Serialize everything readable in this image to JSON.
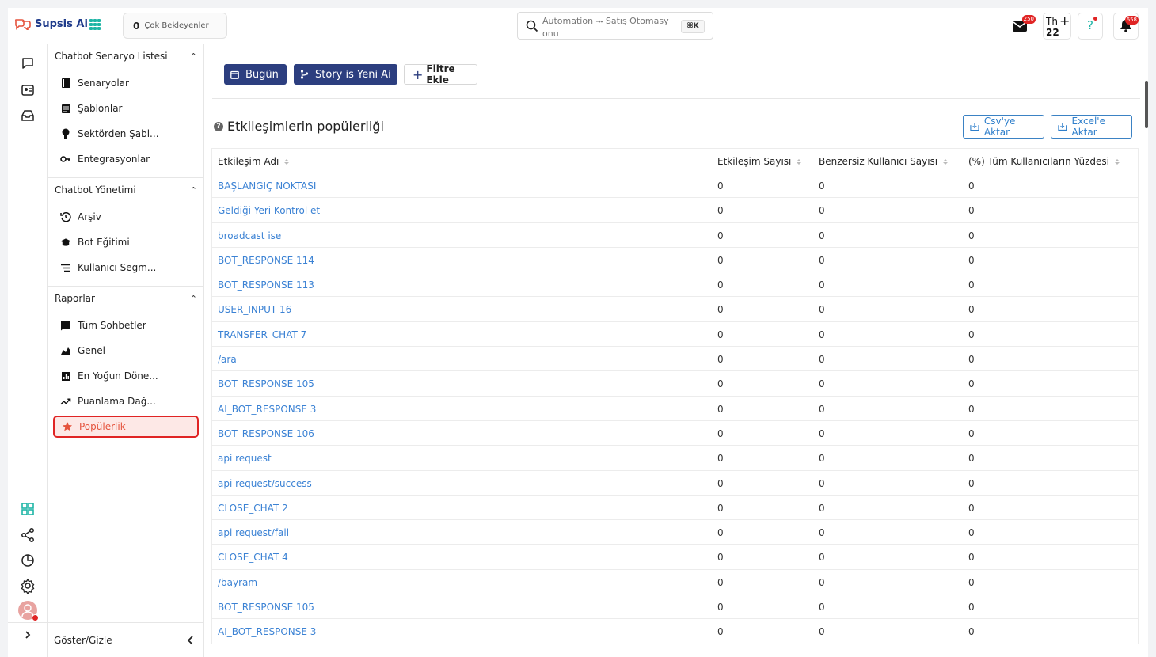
{
  "app": {
    "logo_text": "Supsis Ai"
  },
  "topbar": {
    "pending_count": "0",
    "pending_label": "Çok Bekleyenler",
    "search_text": "Automation ⤞ Satış Otomasy onu",
    "search_shortcut": "⌘K",
    "mail_badge": "250",
    "th_label": "Th",
    "th_count": "22",
    "help_label": "?",
    "bell_badge": "658"
  },
  "sidebar": {
    "sections": [
      {
        "title": "Chatbot Senaryo Listesi",
        "items": [
          "Senaryolar",
          "Şablonlar",
          "Sektörden Şabl...",
          "Entegrasyonlar"
        ]
      },
      {
        "title": "Chatbot Yönetimi",
        "items": [
          "Arşiv",
          "Bot Eğitimi",
          "Kullanıcı Segm..."
        ]
      },
      {
        "title": "Raporlar",
        "items": [
          "Tüm Sohbetler",
          "Genel",
          "En Yoğun Döne...",
          "Puanlama Dağ...",
          "Popülerlik"
        ]
      }
    ],
    "footer_label": "Göster/Gizle"
  },
  "toolbar": {
    "today_label": "Bugün",
    "story_label": "Story is Yeni Ai",
    "filter_label": "Filtre Ekle"
  },
  "section": {
    "title": "Etkileşimlerin popülerliği",
    "csv_label": "Csv'ye Aktar",
    "excel_label": "Excel'e Aktar"
  },
  "table": {
    "headers": [
      "Etkileşim Adı",
      "Etkileşim Sayısı",
      "Benzersiz Kullanıcı Sayısı",
      "(%) Tüm Kullanıcıların Yüzdesi"
    ],
    "rows": [
      [
        "BAŞLANGIÇ NOKTASI",
        "0",
        "0",
        "0"
      ],
      [
        "Geldiği Yeri Kontrol et",
        "0",
        "0",
        "0"
      ],
      [
        "broadcast ise",
        "0",
        "0",
        "0"
      ],
      [
        "BOT_RESPONSE 114",
        "0",
        "0",
        "0"
      ],
      [
        "BOT_RESPONSE 113",
        "0",
        "0",
        "0"
      ],
      [
        "USER_INPUT 16",
        "0",
        "0",
        "0"
      ],
      [
        "TRANSFER_CHAT 7",
        "0",
        "0",
        "0"
      ],
      [
        "/ara",
        "0",
        "0",
        "0"
      ],
      [
        "BOT_RESPONSE 105",
        "0",
        "0",
        "0"
      ],
      [
        "AI_BOT_RESPONSE 3",
        "0",
        "0",
        "0"
      ],
      [
        "BOT_RESPONSE 106",
        "0",
        "0",
        "0"
      ],
      [
        "api request",
        "0",
        "0",
        "0"
      ],
      [
        "api request/success",
        "0",
        "0",
        "0"
      ],
      [
        "CLOSE_CHAT 2",
        "0",
        "0",
        "0"
      ],
      [
        "api request/fail",
        "0",
        "0",
        "0"
      ],
      [
        "CLOSE_CHAT 4",
        "0",
        "0",
        "0"
      ],
      [
        "/bayram",
        "0",
        "0",
        "0"
      ],
      [
        "BOT_RESPONSE 105",
        "0",
        "0",
        "0"
      ],
      [
        "AI_BOT_RESPONSE 3",
        "0",
        "0",
        "0"
      ]
    ]
  }
}
